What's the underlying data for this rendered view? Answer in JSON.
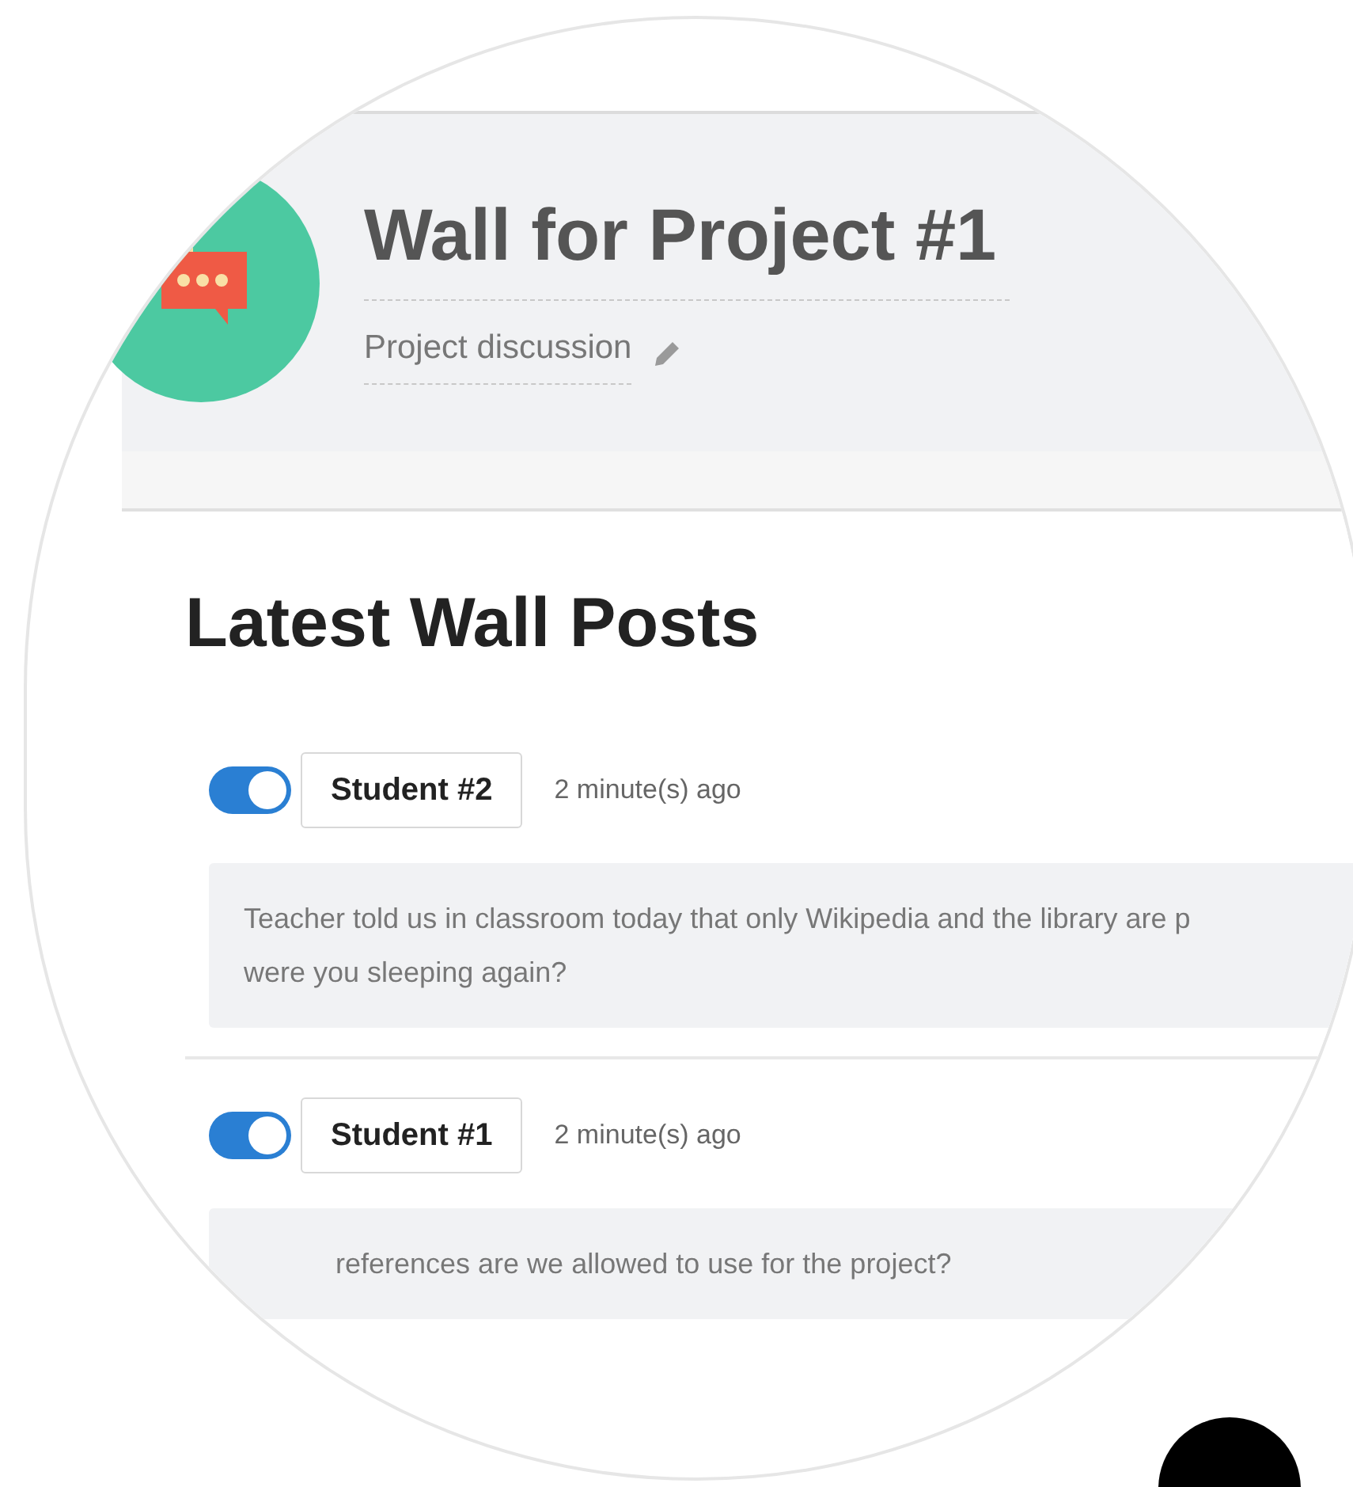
{
  "header": {
    "title": "Wall for Project #1",
    "subtitle": "Project discussion"
  },
  "section": {
    "title": "Latest Wall Posts"
  },
  "posts": [
    {
      "author": "Student #2",
      "time": "2 minute(s) ago",
      "on": true,
      "text": "Teacher told us in classroom today that only Wikipedia and the library are p\nwere you sleeping again?"
    },
    {
      "author": "Student #1",
      "time": "2 minute(s) ago",
      "on": true,
      "text": "references are we allowed to use for the project?"
    }
  ]
}
